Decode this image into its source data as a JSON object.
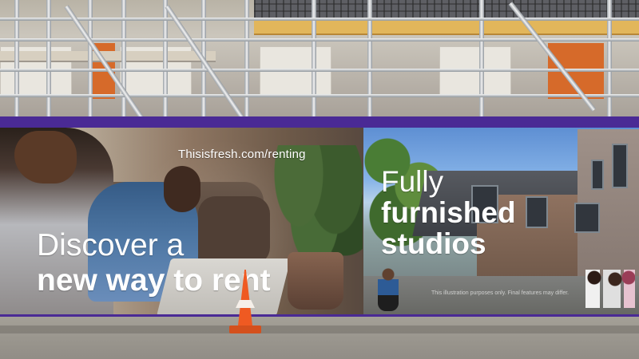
{
  "banner": {
    "website": "Thisisfresh.com/renting",
    "left_headline": {
      "line1": "Discover a",
      "line2": "new way to rent"
    },
    "right_headline": {
      "line1": "Fully",
      "line2": "furnished",
      "line3": "studios"
    },
    "small_print": "This illustration purposes only. Final features may differ."
  }
}
